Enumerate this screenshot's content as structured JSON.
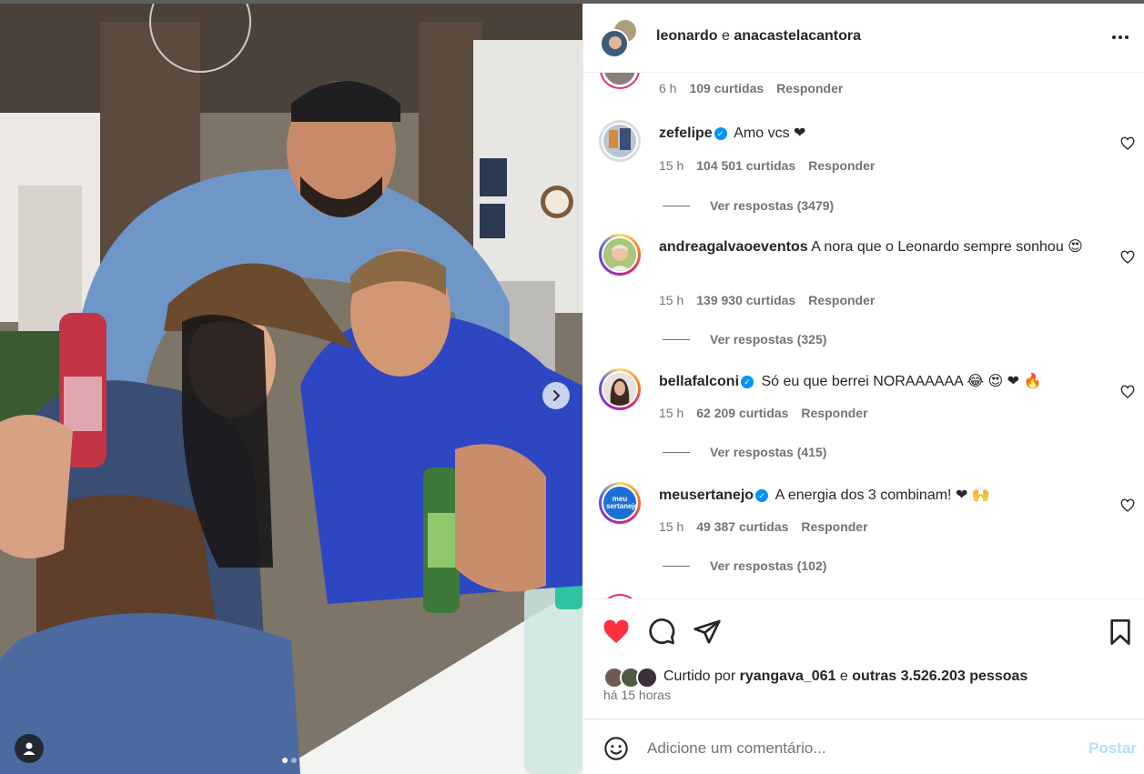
{
  "post": {
    "header_user1": "leonardo",
    "header_joiner": "e",
    "header_user2": "anacastelacantora"
  },
  "comments": {
    "partial": {
      "time": "6 h",
      "likes": "109 curtidas",
      "reply": "Responder"
    },
    "items": [
      {
        "username": "zefelipe",
        "verified": true,
        "text": "Amo vcs ❤",
        "time": "15 h",
        "likes": "104 501 curtidas",
        "reply": "Responder",
        "replies": "Ver respostas (3479)"
      },
      {
        "username": "andreagalvaoeventos",
        "verified": false,
        "text": "A nora que o Leonardo sempre sonhou 😍",
        "time": "15 h",
        "likes": "139 930 curtidas",
        "reply": "Responder",
        "replies": "Ver respostas (325)"
      },
      {
        "username": "bellafalconi",
        "verified": true,
        "text": "Só eu que berrei NORAAAAAA 😂 😍 ❤ 🔥",
        "time": "15 h",
        "likes": "62 209 curtidas",
        "reply": "Responder",
        "replies": "Ver respostas (415)"
      },
      {
        "username": "meusertanejo",
        "verified": true,
        "text": "A energia dos 3 combinam! ❤ 🙌",
        "time": "15 h",
        "likes": "49 387 curtidas",
        "reply": "Responder",
        "replies": "Ver respostas (102)"
      }
    ]
  },
  "likes": {
    "prefix": "Curtido por",
    "user": "ryangava_061",
    "joiner": "e",
    "others": "outras 3.526.203 pessoas"
  },
  "time_ago": "há 15 horas",
  "comment_box": {
    "placeholder": "Adicione um comentário...",
    "post_label": "Postar"
  },
  "avatar_texts": {
    "meusertanejo": "meu sertanejo"
  },
  "colors": {
    "like_red": "#ff3040",
    "verified_blue": "#0095f6",
    "post_disabled": "#b2dffc",
    "muted_text": "#737373"
  },
  "icons": [
    "heart-filled-icon",
    "comment-icon",
    "share-icon",
    "bookmark-icon",
    "emoji-icon",
    "heart-outline-icon",
    "chevron-right-icon",
    "user-tag-icon",
    "more-icon",
    "verified-icon"
  ]
}
